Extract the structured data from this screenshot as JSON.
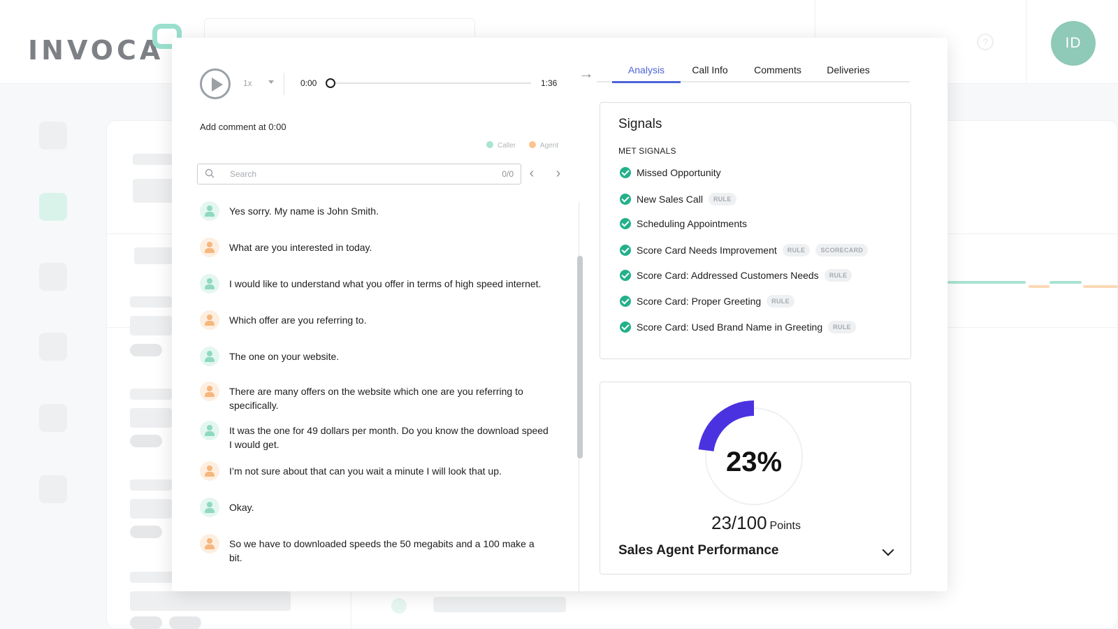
{
  "app": {
    "logo_text": "INVOCA",
    "user_initials": "ID",
    "help_icon_glyph": "?"
  },
  "player": {
    "speed": "1x",
    "current_time": "0:00",
    "duration": "1:36",
    "progress": 0
  },
  "transcript": {
    "add_comment": "Add comment at 0:00",
    "legend_caller": "Caller",
    "legend_agent": "Agent",
    "search_placeholder": "Search",
    "search_count": "0/0",
    "lines": [
      {
        "speaker": "caller",
        "text": "Yes sorry. My name is John Smith."
      },
      {
        "speaker": "agent",
        "text": "What are you interested in today."
      },
      {
        "speaker": "caller",
        "text": "I would like to understand what you offer in terms of high speed internet."
      },
      {
        "speaker": "agent",
        "text": "Which offer are you referring to."
      },
      {
        "speaker": "caller",
        "text": "The one on your website."
      },
      {
        "speaker": "agent",
        "text": "There are many offers on the website which one are you referring to specifically."
      },
      {
        "speaker": "caller",
        "text": "It was the one for 49 dollars per month. Do you know the download speed I would get."
      },
      {
        "speaker": "agent",
        "text": "I’m not sure about that can you wait a minute I will look that up."
      },
      {
        "speaker": "caller",
        "text": "Okay."
      },
      {
        "speaker": "agent",
        "text": "So we have to downloaded speeds the 50 megabits and a 100 make a bit."
      }
    ]
  },
  "tabs": [
    "Analysis",
    "Call Info",
    "Comments",
    "Deliveries"
  ],
  "signals": {
    "title": "Signals",
    "met_label": "MET SIGNALS",
    "items": [
      {
        "label": "Missed Opportunity",
        "tags": []
      },
      {
        "label": "New Sales Call",
        "tags": [
          "RULE"
        ]
      },
      {
        "label": "Scheduling Appointments",
        "tags": []
      },
      {
        "label": "Score Card Needs Improvement",
        "tags": [
          "RULE",
          "SCORECARD"
        ]
      },
      {
        "label": "Score Card: Addressed Customers Needs",
        "tags": [
          "RULE"
        ]
      },
      {
        "label": "Score Card: Proper Greeting",
        "tags": [
          "RULE"
        ]
      },
      {
        "label": "Score Card: Used Brand Name in Greeting",
        "tags": [
          "RULE"
        ]
      }
    ]
  },
  "score": {
    "percent": 23,
    "percent_label": "23%",
    "points": "23/100",
    "points_unit": "Points",
    "title": "Sales Agent Performance"
  },
  "colors": {
    "accent": "#4d63d8",
    "score_arc": "#4a32e0",
    "check": "#23b08a",
    "caller": "#8fd9c1",
    "agent": "#f5b77d",
    "avatar": "#8fc9b8",
    "logo_bubble": "#9be0cf"
  }
}
